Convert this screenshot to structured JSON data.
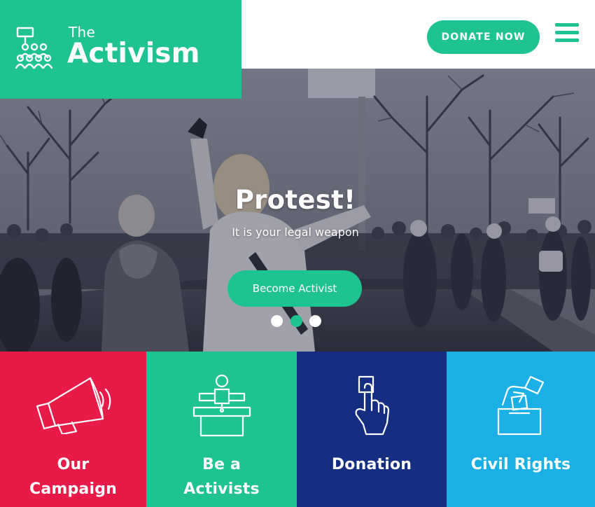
{
  "brand": {
    "the": "The",
    "name": "Activism",
    "logo_icon": "people-group-sign-icon",
    "color": "#1fc391"
  },
  "header": {
    "donate_label": "DONATE NOW",
    "menu_icon": "hamburger-menu-icon"
  },
  "hero": {
    "title": "Protest!",
    "subtitle": "It is your legal weapon",
    "cta_label": "Become Activist",
    "slides_total": 3,
    "active_slide": 2
  },
  "tiles": [
    {
      "line1": "Our",
      "line2": "Campaign",
      "icon": "megaphone-icon",
      "color": "#e81a48"
    },
    {
      "line1": "Be a",
      "line2": "Activists",
      "icon": "speaker-podium-icon",
      "color": "#1fc391"
    },
    {
      "line1": "Donation",
      "line2": "",
      "icon": "hand-press-button-icon",
      "color": "#152e82"
    },
    {
      "line1": "Civil Rights",
      "line2": "",
      "icon": "ballot-box-icon",
      "color": "#1ab0e6"
    }
  ]
}
